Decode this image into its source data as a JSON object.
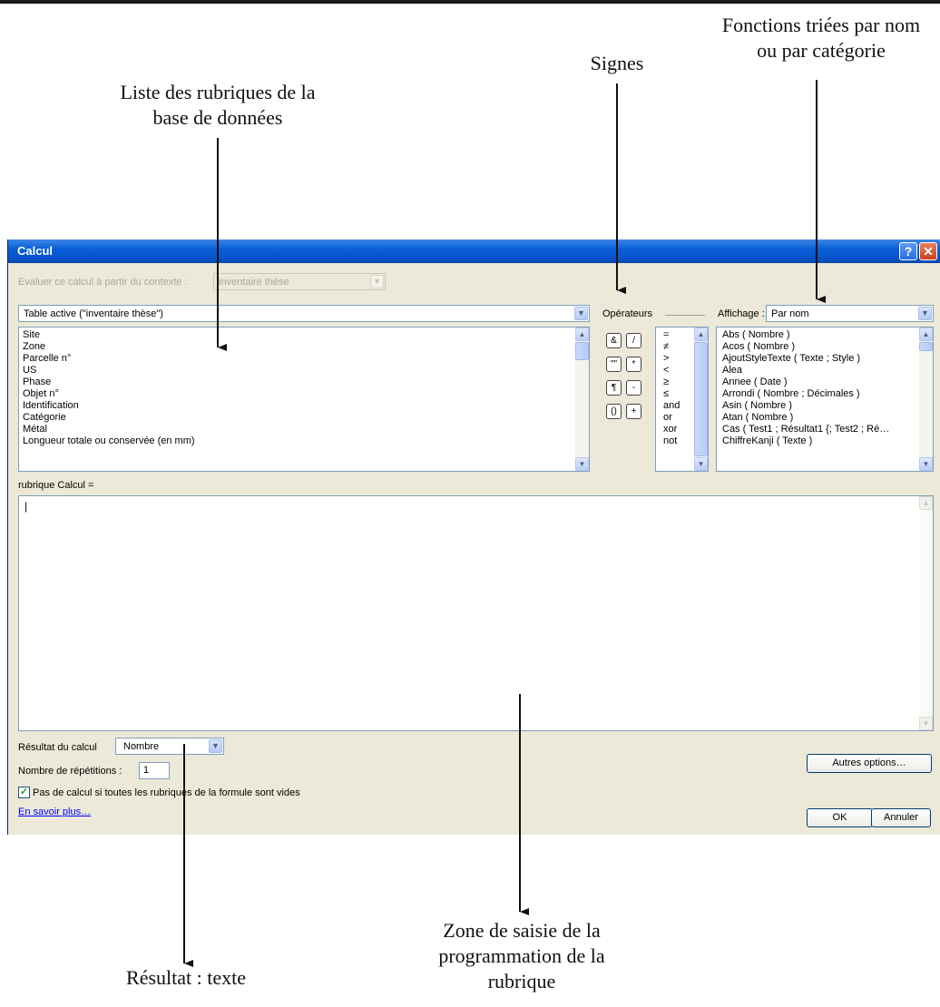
{
  "annotations": {
    "fonctions": [
      "Fonctions triées par nom",
      "ou par catégorie"
    ],
    "signes": "Signes",
    "liste": [
      "Liste des rubriques de la",
      "base de données"
    ],
    "zone": [
      "Zone de saisie de la",
      "programmation de la",
      "rubrique"
    ],
    "resultat": "Résultat : texte"
  },
  "dialog": {
    "title": "Calcul",
    "help_label": "?",
    "close_label": "✕",
    "context_label": "Evaluer ce calcul à partir du contexte :",
    "context_value": "inventaire thèse",
    "table_value": "Table active (\"inventaire thèse\")",
    "fields": [
      "Site",
      "Zone",
      "Parcelle n°",
      "US",
      "Phase",
      "Objet n°",
      "Identification",
      "Catégorie",
      "Métal",
      "Longueur totale ou conservée (en mm)"
    ],
    "operators_label": "Opérateurs",
    "operator_buttons": [
      "&",
      "/",
      "\"\"",
      "*",
      "¶",
      "-",
      "()",
      "+"
    ],
    "operators": [
      "=",
      "≠",
      ">",
      "<",
      "≥",
      "≤",
      "and",
      "or",
      "xor",
      "not"
    ],
    "display_label": "Affichage :",
    "display_value": "Par nom",
    "functions": [
      "Abs ( Nombre )",
      "Acos ( Nombre )",
      "AjoutStyleTexte ( Texte ; Style )",
      "Alea",
      "Annee ( Date )",
      "Arrondi ( Nombre ; Décimales )",
      "Asin ( Nombre )",
      "Atan ( Nombre )",
      "Cas ( Test1 ; Résultat1 {; Test2 ; Ré…",
      "ChiffreKanji ( Texte )"
    ],
    "formula_label": "rubrique Calcul =",
    "formula_text": "|",
    "result_label": "Résultat du calcul",
    "result_value": "Nombre",
    "repeat_label": "Nombre de répétitions :",
    "repeat_value": "1",
    "checkbox_label": "Pas de calcul si toutes les rubriques de la formule sont vides",
    "checkbox_mark": "✓",
    "learn_more": "En savoir plus…",
    "other_options": "Autres options…",
    "ok": "OK",
    "cancel": "Annuler"
  },
  "colors": {
    "titlebar": "#0552c9",
    "dialog_bg": "#ece9d8",
    "border": "#7f9db9"
  }
}
